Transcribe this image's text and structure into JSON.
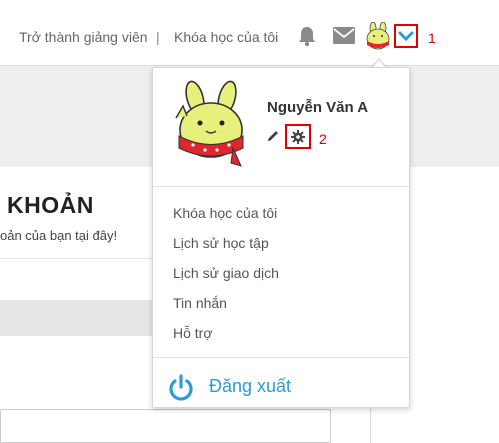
{
  "header": {
    "become_instructor": "Trở thành giảng viên",
    "separator": "|",
    "my_courses": "Khóa học của tôi",
    "callout_1": "1"
  },
  "page": {
    "heading": "KHOẢN",
    "subtext": "oản của bạn tại đây!"
  },
  "dropdown": {
    "user_name": "Nguyễn Văn A",
    "callout_2": "2",
    "menu": [
      {
        "label": "Khóa học của tôi"
      },
      {
        "label": "Lịch sử học tập"
      },
      {
        "label": "Lịch sử giao dịch"
      },
      {
        "label": "Tin nhắn"
      },
      {
        "label": "Hỗ trợ"
      }
    ],
    "logout": "Đăng xuất"
  },
  "colors": {
    "accent": "#2f9ad6",
    "callout_red": "#e00000",
    "icon_gray": "#8a8a8a"
  },
  "icons": [
    "bell-icon",
    "mail-icon",
    "chevron-down-icon",
    "pencil-icon",
    "gear-icon",
    "power-icon"
  ]
}
